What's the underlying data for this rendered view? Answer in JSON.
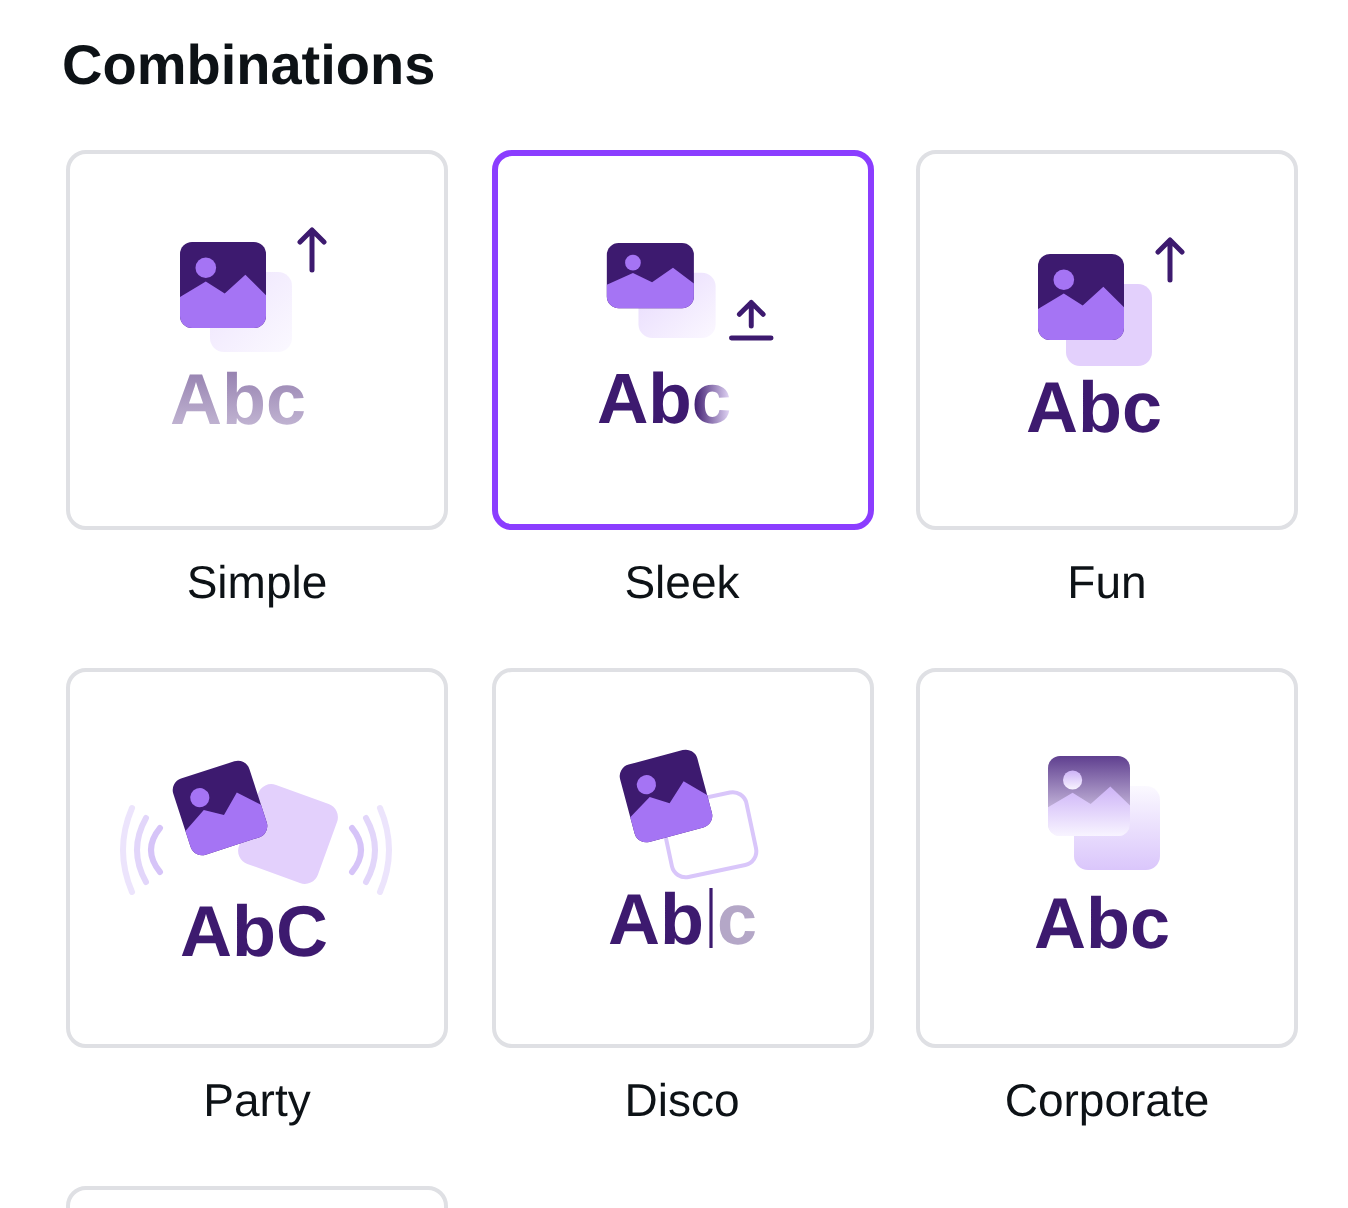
{
  "panel": {
    "title": "Combinations"
  },
  "styles": [
    {
      "label": "Simple",
      "kind": "simple",
      "preview_text": "Abc",
      "selected": false
    },
    {
      "label": "Sleek",
      "kind": "sleek",
      "preview_text": "Abc",
      "selected": true
    },
    {
      "label": "Fun",
      "kind": "fun",
      "preview_text": "Abc",
      "selected": false
    },
    {
      "label": "Party",
      "kind": "party",
      "preview_text": "AbC",
      "selected": false
    },
    {
      "label": "Disco",
      "kind": "disco",
      "preview_text": "Ab",
      "faded_text": "c",
      "selected": false
    },
    {
      "label": "Corporate",
      "kind": "corporate",
      "preview_text": "Abc",
      "selected": false
    },
    {
      "selected": false
    }
  ]
}
